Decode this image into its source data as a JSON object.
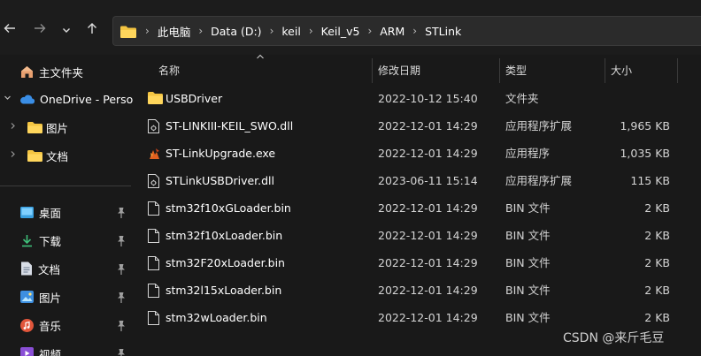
{
  "breadcrumb": [
    "此电脑",
    "Data (D:)",
    "keil",
    "Keil_v5",
    "ARM",
    "STLink"
  ],
  "sidebar": {
    "items": [
      {
        "label": "主文件夹",
        "icon": "home-icon"
      },
      {
        "label": "OneDrive - Perso",
        "icon": "cloud-icon"
      },
      {
        "label": "图片",
        "icon": "folder-icon"
      },
      {
        "label": "文档",
        "icon": "folder-icon"
      },
      {
        "label": "桌面",
        "icon": "desktop-icon"
      },
      {
        "label": "下载",
        "icon": "download-icon"
      },
      {
        "label": "文档",
        "icon": "document-icon"
      },
      {
        "label": "图片",
        "icon": "picture-icon"
      },
      {
        "label": "音乐",
        "icon": "music-icon"
      },
      {
        "label": "视频",
        "icon": "video-icon"
      }
    ]
  },
  "columns": {
    "name": "名称",
    "date": "修改日期",
    "type": "类型",
    "size": "大小"
  },
  "files": [
    {
      "name": "USBDriver",
      "date": "2022-10-12 15:40",
      "type": "文件夹",
      "size": "",
      "icon": "folder-icon"
    },
    {
      "name": "ST-LINKIII-KEIL_SWO.dll",
      "date": "2022-12-01 14:29",
      "type": "应用程序扩展",
      "size": "1,965 KB",
      "icon": "dll-file-icon"
    },
    {
      "name": "ST-LinkUpgrade.exe",
      "date": "2022-12-01 14:29",
      "type": "应用程序",
      "size": "1,035 KB",
      "icon": "exe-app-icon"
    },
    {
      "name": "STLinkUSBDriver.dll",
      "date": "2023-06-11 15:14",
      "type": "应用程序扩展",
      "size": "115 KB",
      "icon": "dll-file-icon"
    },
    {
      "name": "stm32f10xGLoader.bin",
      "date": "2022-12-01 14:29",
      "type": "BIN 文件",
      "size": "2 KB",
      "icon": "file-icon"
    },
    {
      "name": "stm32f10xLoader.bin",
      "date": "2022-12-01 14:29",
      "type": "BIN 文件",
      "size": "2 KB",
      "icon": "file-icon"
    },
    {
      "name": "stm32F20xLoader.bin",
      "date": "2022-12-01 14:29",
      "type": "BIN 文件",
      "size": "2 KB",
      "icon": "file-icon"
    },
    {
      "name": "stm32l15xLoader.bin",
      "date": "2022-12-01 14:29",
      "type": "BIN 文件",
      "size": "2 KB",
      "icon": "file-icon"
    },
    {
      "name": "stm32wLoader.bin",
      "date": "2022-12-01 14:29",
      "type": "BIN 文件",
      "size": "2 KB",
      "icon": "file-icon"
    }
  ],
  "watermark": "CSDN @来斤毛豆",
  "colors": {
    "background": "#191919",
    "folder": "#f4c542",
    "onedrive": "#3a8ee6"
  }
}
